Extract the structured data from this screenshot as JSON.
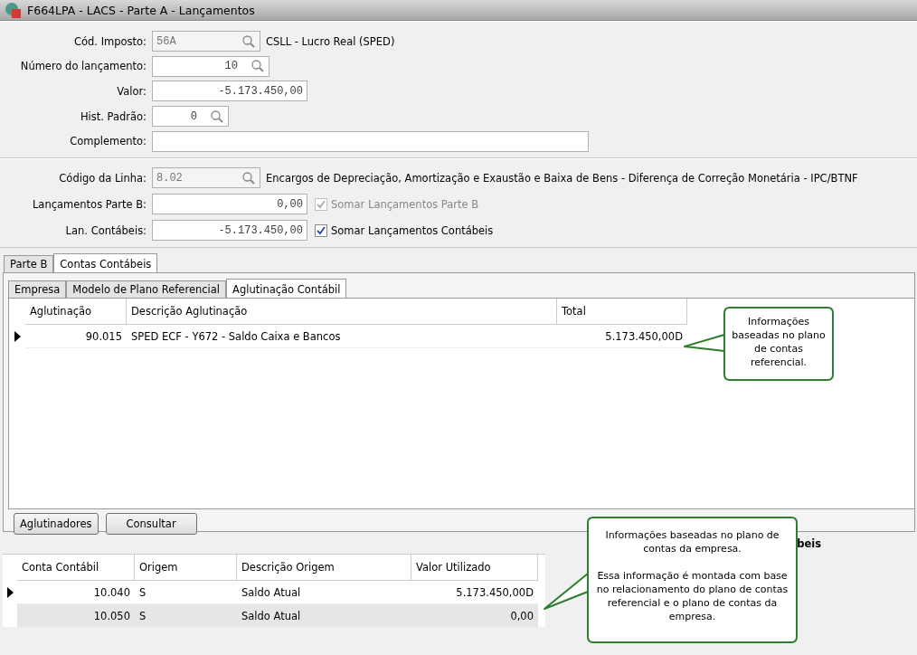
{
  "window": {
    "title": "F664LPA - LACS - Parte A - Lançamentos"
  },
  "header": {
    "fields": [
      {
        "label": "Cód. Imposto:",
        "kind": "lookup",
        "value": "56A",
        "disabled": true,
        "description": "CSLL - Lucro Real (SPED)"
      },
      {
        "label": "Número do lançamento:",
        "kind": "lookup",
        "value": "10"
      },
      {
        "label": "Valor:",
        "kind": "amount",
        "value": "-5.173.450,00"
      },
      {
        "label": "Hist. Padrão:",
        "kind": "lookup",
        "value": "0"
      },
      {
        "label": "Complemento:",
        "kind": "text"
      }
    ]
  },
  "line": {
    "fields": [
      {
        "label": "Código da Linha:",
        "kind": "lookup",
        "value": "8.02",
        "disabled": true,
        "description": "Encargos de Depreciação, Amortização e Exaustão e Baixa de Bens - Diferença de Correção Monetária - IPC/BTNF"
      },
      {
        "label": "Lançamentos Parte B:",
        "kind": "amount",
        "value": "0,00",
        "checkbox": {
          "label": "Somar Lançamentos Parte B",
          "checked": true,
          "disabled": true
        }
      },
      {
        "label": "Lan. Contábeis:",
        "kind": "amount",
        "value": "-5.173.450,00",
        "checkbox": {
          "label": "Somar Lançamentos Contábeis",
          "checked": true,
          "disabled": false
        }
      }
    ]
  },
  "tabs": [
    {
      "label": "Parte B",
      "selected": false
    },
    {
      "label": "Contas Contábeis",
      "selected": true
    }
  ],
  "subtabs": [
    {
      "label": "Empresa",
      "selected": false
    },
    {
      "label": "Modelo de Plano Referencial",
      "selected": false
    },
    {
      "label": "Aglutinação Contábil",
      "selected": true
    }
  ],
  "aglutinacao_table": {
    "columns": [
      "Aglutinação",
      "Descrição Aglutinação",
      "Total"
    ],
    "rows": [
      {
        "current": true,
        "cells": [
          "90.015",
          "SPED ECF - Y672 - Saldo Caixa e Bancos",
          "5.173.450,00D"
        ]
      }
    ]
  },
  "buttons": [
    "Aglutinadores",
    "Consultar"
  ],
  "section_title": "beis",
  "contas_table": {
    "columns": [
      "Conta Contábil",
      "Origem",
      "Descrição Origem",
      "Valor Utilizado"
    ],
    "rows": [
      {
        "current": true,
        "cells": [
          "10.040",
          "S",
          "Saldo Atual",
          "5.173.450,00D"
        ]
      },
      {
        "current": false,
        "cells": [
          "10.050",
          "S",
          "Saldo Atual",
          "0,00"
        ]
      }
    ]
  },
  "callouts": [
    {
      "paragraphs": [
        "Informações baseadas no plano de contas referencial."
      ]
    },
    {
      "paragraphs": [
        "Informações baseadas no plano de contas da empresa.",
        "Essa informação é montada com base no relacionamento do plano de contas referencial e o plano de contas da empresa."
      ]
    }
  ]
}
